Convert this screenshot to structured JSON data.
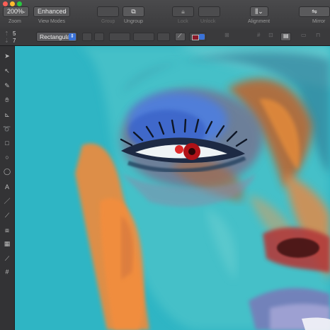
{
  "toolbar": {
    "zoom_value": "200%",
    "zoom_label": "Zoom",
    "view_mode_value": "Enhanced",
    "view_mode_label": "View Modes",
    "group_label": "Group",
    "ungroup_label": "Ungroup",
    "lock_label": "Lock",
    "unlock_label": "Unlock",
    "alignment_label": "Alignment",
    "mirror_label": "Mirror"
  },
  "options": {
    "top_value": "5",
    "bottom_value": "7",
    "shape_mode": "Rectangular"
  },
  "tools": [
    "pointer-icon",
    "direct-select-icon",
    "pen-icon",
    "hand-icon",
    "ruler-icon",
    "lasso-icon",
    "rectangle-icon",
    "ellipse-icon",
    "circle-icon",
    "text-icon",
    "line-icon",
    "knife-icon",
    "crop-icon",
    "layers-icon",
    "eyedropper-icon",
    "grid-icon"
  ],
  "colors": {
    "accent": "#3a72d8",
    "canvas": "#2fb5c4",
    "toolbar": "#3f3f41"
  }
}
